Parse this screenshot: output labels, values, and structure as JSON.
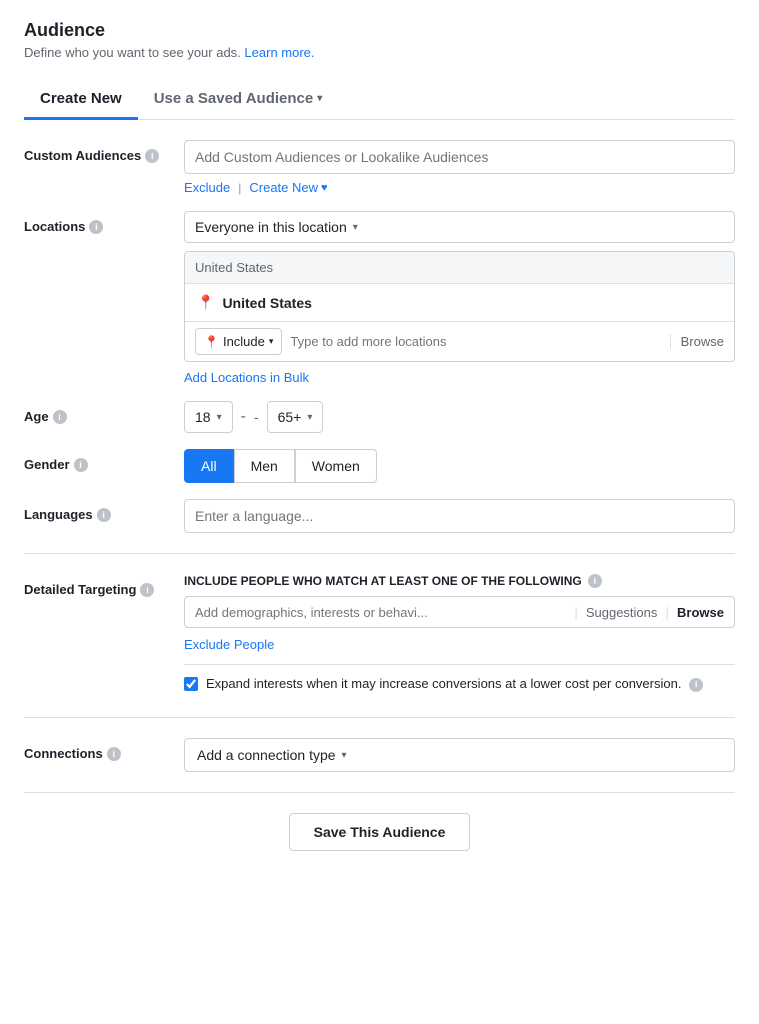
{
  "page": {
    "title": "Audience",
    "subtitle": "Define who you want to see your ads.",
    "learn_more": "Learn more."
  },
  "tabs": {
    "create_new": "Create New",
    "use_saved": "Use a Saved Audience",
    "active": "create_new"
  },
  "custom_audiences": {
    "label": "Custom Audiences",
    "placeholder": "Add Custom Audiences or Lookalike Audiences",
    "exclude_link": "Exclude",
    "create_new_link": "Create New"
  },
  "locations": {
    "label": "Locations",
    "dropdown_label": "Everyone in this location",
    "location_header": "United States",
    "location_name": "United States",
    "include_label": "Include",
    "type_placeholder": "Type to add more locations",
    "browse_label": "Browse",
    "add_bulk_link": "Add Locations in Bulk"
  },
  "age": {
    "label": "Age",
    "min": "18",
    "max": "65+",
    "separator": "-"
  },
  "gender": {
    "label": "Gender",
    "all": "All",
    "men": "Men",
    "women": "Women",
    "active": "all"
  },
  "languages": {
    "label": "Languages",
    "placeholder": "Enter a language..."
  },
  "detailed_targeting": {
    "label": "Detailed Targeting",
    "description": "INCLUDE people who match at least ONE of the following",
    "placeholder": "Add demographics, interests or behavi...",
    "suggestions_label": "Suggestions",
    "browse_label": "Browse",
    "exclude_people_link": "Exclude People",
    "expand_label": "Expand interests when it may increase conversions at a lower cost per conversion.",
    "expand_checked": true
  },
  "connections": {
    "label": "Connections",
    "dropdown_label": "Add a connection type"
  },
  "save_button": "Save This Audience",
  "icons": {
    "info": "i",
    "caret_down": "▾",
    "pin": "📍",
    "heart": "♥"
  }
}
